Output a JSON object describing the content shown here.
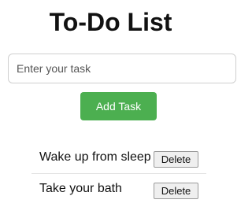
{
  "app": {
    "title": "To-Do List"
  },
  "input": {
    "placeholder": "Enter your task",
    "value": ""
  },
  "add_button": {
    "label": "Add Task"
  },
  "tasks": [
    {
      "text": "Wake up from sleep",
      "delete_label": "Delete"
    },
    {
      "text": "Take your bath",
      "delete_label": "Delete"
    }
  ],
  "colors": {
    "accent": "#4caf50",
    "background": "#ffffff",
    "divider": "#e3e3e3"
  }
}
